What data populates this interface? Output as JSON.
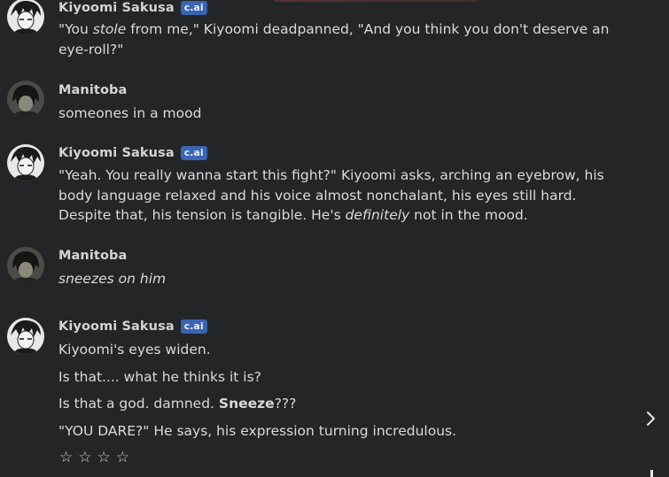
{
  "messages": [
    {
      "author": "Kiyoomi Sakusa",
      "badge": "c.ai",
      "avatar_icon": "kiyoomi-avatar-icon",
      "text_parts": {
        "p1": "\"You ",
        "p1_em": "stole",
        "p1_end": " from me,\" Kiyoomi deadpanned, \"And you think you don't deserve an eye-roll?\""
      }
    },
    {
      "author": "Manitoba",
      "avatar_icon": "manitoba-avatar-icon",
      "text": "someones in a mood"
    },
    {
      "author": "Kiyoomi Sakusa",
      "badge": "c.ai",
      "avatar_icon": "kiyoomi-avatar-icon",
      "text_parts": {
        "p1": "\"Yeah. You really wanna start this fight?\" Kiyoomi asks, arching an eyebrow, his body language relaxed and his voice almost nonchalant, his eyes still hard. Despite that, his tension is tangible. He's ",
        "p1_em": "definitely",
        "p1_end": " not in the mood."
      }
    },
    {
      "author": "Manitoba",
      "avatar_icon": "manitoba-avatar-icon",
      "text_em": "sneezes on him"
    },
    {
      "author": "Kiyoomi Sakusa",
      "badge": "c.ai",
      "avatar_icon": "kiyoomi-avatar-icon",
      "lines": {
        "l1": "Kiyoomi's eyes widen.",
        "l2": "Is that.... what he thinks it is?",
        "l3_pre": "Is that a god. damned. ",
        "l3_bold": "Sneeze",
        "l3_post": "???",
        "l4": "\"YOU DARE?\" He says, his expression turning incredulous."
      }
    }
  ],
  "rating": {
    "stars": [
      "☆",
      "☆",
      "☆",
      "☆"
    ],
    "value": 0,
    "max": 4
  },
  "controls": {
    "next_icon": "chevron-right-icon"
  },
  "colors": {
    "background": "#242526",
    "badge": "#3a64b4",
    "text": "#dadada"
  }
}
